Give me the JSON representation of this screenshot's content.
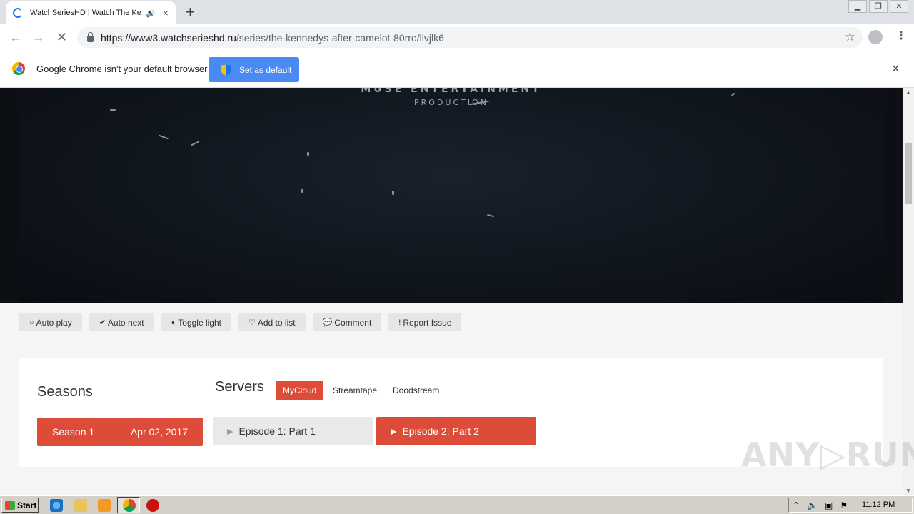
{
  "browser": {
    "tab_title": "WatchSeriesHD | Watch The Ke",
    "tab_speaker_icon": "speaker-icon",
    "tab_close": "×",
    "new_tab": "+",
    "url_host": "https://www3.watchserieshd.ru",
    "url_path": "/series/the-kennedys-after-camelot-80rro/llvjlk6"
  },
  "infobar": {
    "message": "Google Chrome isn't your default browser",
    "button_label": "Set as default",
    "close": "×"
  },
  "player": {
    "logo_line1": "MUSE ENTERTAINMENT",
    "logo_line2": "PRODUCTION"
  },
  "controls": [
    {
      "icon": "○",
      "label": "Auto play"
    },
    {
      "icon": "✔",
      "label": "Auto next"
    },
    {
      "icon": "◐",
      "label": "Toggle light"
    },
    {
      "icon": "♡",
      "label": "Add to list"
    },
    {
      "icon": "💬",
      "label": "Comment"
    },
    {
      "icon": "!",
      "label": "Report Issue"
    }
  ],
  "content": {
    "seasons_title": "Seasons",
    "servers_title": "Servers",
    "servers": [
      "MyCloud",
      "Streamtape",
      "Doodstream"
    ],
    "active_server": "MyCloud",
    "season": {
      "label": "Season 1",
      "date": "Apr 02, 2017"
    },
    "episodes": [
      {
        "label": "Episode 1: Part 1",
        "active": false
      },
      {
        "label": "Episode 2: Part 2",
        "active": true
      }
    ]
  },
  "watermark": "ANY▷RUN",
  "taskbar": {
    "start_label": "Start",
    "clock": "11:12 PM"
  },
  "colors": {
    "accent_red": "#dd4b39",
    "chrome_blue": "#4a8af4"
  }
}
